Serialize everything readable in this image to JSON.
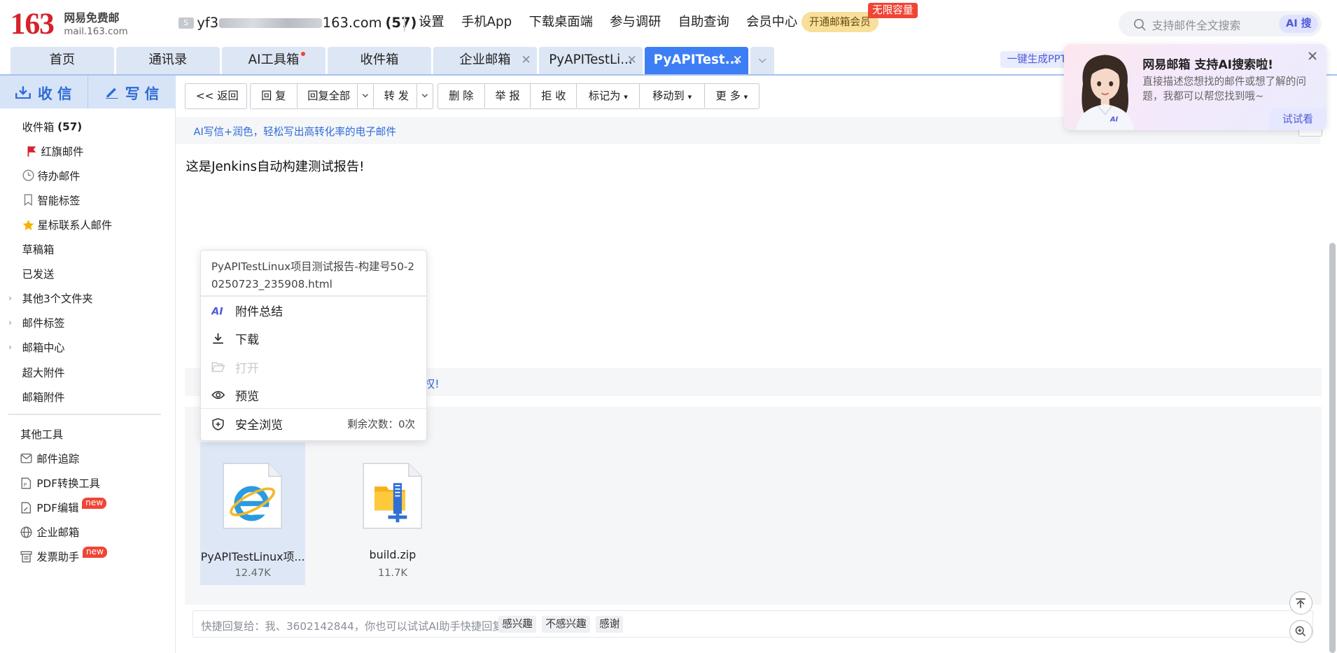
{
  "header": {
    "logo_number": "163",
    "logo_name": "网易免费邮",
    "logo_domain": "mail.163.com",
    "account_prefix": "yf3",
    "account_suffix": "163.com",
    "account_count": "(57)",
    "nav": [
      "设置",
      "手机App",
      "下载桌面端",
      "参与调研",
      "自助查询",
      "会员中心"
    ],
    "vip_label": "开通邮箱会员",
    "vip_badge": "无限容量",
    "search_placeholder": "支持邮件全文搜索",
    "ai_search": "AI 搜"
  },
  "tabs": [
    {
      "label": "首页"
    },
    {
      "label": "通讯录"
    },
    {
      "label": "AI工具箱"
    },
    {
      "label": "收件箱"
    },
    {
      "label": "企业邮箱"
    },
    {
      "label": "PyAPITestLi..."
    },
    {
      "label": "PyAPITest..."
    }
  ],
  "ppt_label": "一键生成PPT",
  "sidebar": {
    "receive": "收 信",
    "compose": "写 信",
    "inbox": "收件箱",
    "inbox_count": "(57)",
    "items": [
      "红旗邮件",
      "待办邮件",
      "智能标签",
      "星标联系人邮件",
      "草稿箱",
      "已发送",
      "其他3个文件夹",
      "邮件标签",
      "邮箱中心",
      "超大附件",
      "邮箱附件"
    ],
    "tools_title": "其他工具",
    "tools": [
      "邮件追踪",
      "PDF转换工具",
      "PDF编辑",
      "企业邮箱",
      "发票助手"
    ],
    "new_badge": "new"
  },
  "toolbar": {
    "back": "<< 返回",
    "reply": "回 复",
    "reply_all": "回复全部",
    "forward": "转 发",
    "delete": "删 除",
    "report": "举 报",
    "reject": "拒 收",
    "mark": "标记为",
    "move": "移动到",
    "more": "更 多"
  },
  "ai_write": "AI写信+润色，轻松写出高转化率的电子邮件",
  "body_text": "这是Jenkins自动构建测试报告!",
  "notice_tail": "权!",
  "attachments": [
    {
      "name": "PyAPITestLinux项...",
      "size": "12.47K"
    },
    {
      "name": "build.zip",
      "size": "11.7K"
    }
  ],
  "context_menu": {
    "filename": "PyAPITestLinux项目测试报告-构建号50-20250723_235908.html",
    "summary": "附件总结",
    "download": "下载",
    "open": "打开",
    "preview": "预览",
    "safe_browse": "安全浏览",
    "remaining": "剩余次数：0次"
  },
  "quick_reply": {
    "text": "快捷回复给：我、3602142844，你也可以试试AI助手快捷回复",
    "chips": [
      "感兴趣",
      "不感兴趣",
      "感谢"
    ]
  },
  "promo": {
    "title": "网易邮箱 支持AI搜索啦!",
    "desc": "直接描述您想找的邮件或想了解的问题，我都可以帮您找到哦~",
    "cta": "试试看",
    "badge": "AI"
  }
}
